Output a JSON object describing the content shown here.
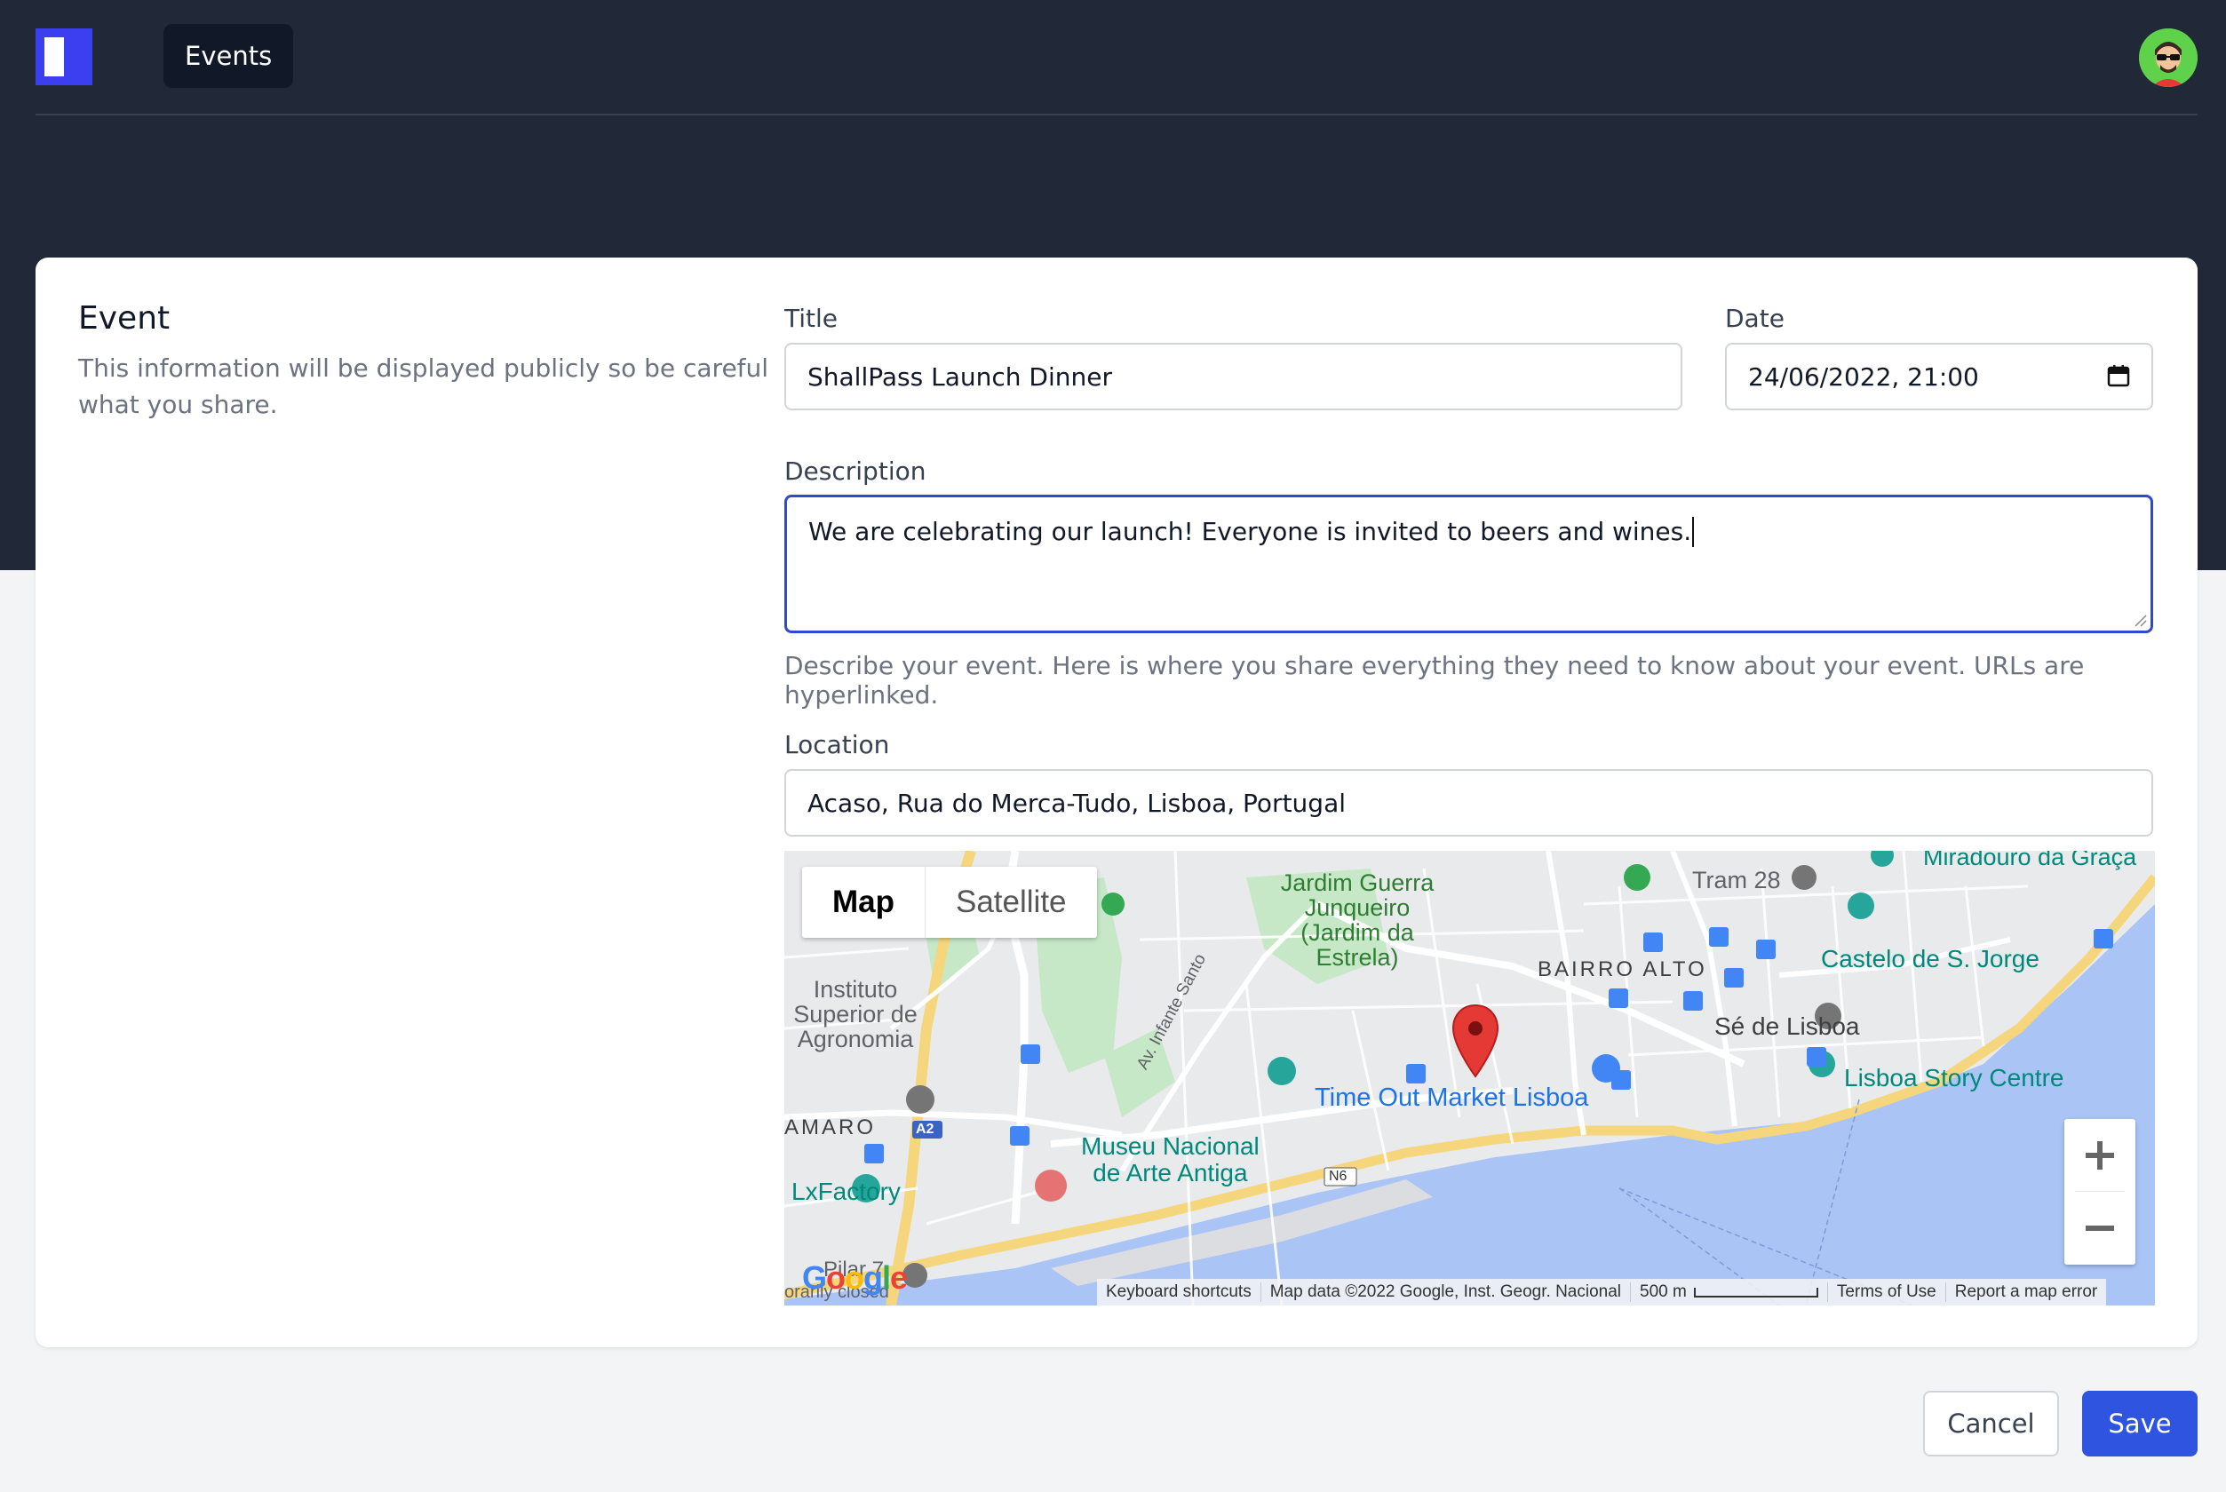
{
  "nav": {
    "tab_events": "Events"
  },
  "section": {
    "title": "Event",
    "description": "This information will be displayed publicly so be careful what you share."
  },
  "form": {
    "title_label": "Title",
    "title_value": "ShallPass Launch Dinner",
    "date_label": "Date",
    "date_value": "24/06/2022, 21:00",
    "description_label": "Description",
    "description_value": "We are celebrating our launch! Everyone is invited to beers and wines.",
    "description_help": "Describe your event. Here is where you share everything they need to know about your event. URLs are hyperlinked.",
    "location_label": "Location",
    "location_value": "Acaso, Rua do Merca-Tudo, Lisboa, Portugal"
  },
  "map": {
    "type_map": "Map",
    "type_satellite": "Satellite",
    "zoom_in": "+",
    "zoom_out": "−",
    "places": {
      "jardim": "Jardim Guerra Junqueiro (Jardim da Estrela)",
      "jardim_l1": "Jardim Guerra",
      "jardim_l2": "Junqueiro",
      "jardim_l3": "(Jardim da",
      "jardim_l4": "Estrela)",
      "instituto_l1": "Instituto",
      "instituto_l2": "Superior de",
      "instituto_l3": "Agronomia",
      "amaro": "AMARO",
      "bairro_alto": "BAIRRO ALTO",
      "tram28": "Tram 28",
      "miradouro": "Miradouro da Graça",
      "castelo": "Castelo de S. Jorge",
      "se": "Sé de Lisboa",
      "story": "Lisboa Story Centre",
      "timeout": "Time Out Market Lisboa",
      "museu_l1": "Museu Nacional",
      "museu_l2": "de Arte Antiga",
      "lxfactory": "LxFactory",
      "pilar": "Pilar 7",
      "closed": "orarily closed",
      "av_infante": "Av. Infante Santo",
      "a2": "A2",
      "n6": "N6"
    },
    "attribution": {
      "shortcuts": "Keyboard shortcuts",
      "data": "Map data ©2022 Google, Inst. Geogr. Nacional",
      "scale": "500 m",
      "terms": "Terms of Use",
      "report": "Report a map error"
    },
    "google_logo": "Google",
    "colors": {
      "water": "#aac4f5",
      "land": "#e9eaec",
      "park": "#c6e8c7",
      "highway": "#f6d67d",
      "marker": "#e53935"
    }
  },
  "actions": {
    "cancel": "Cancel",
    "save": "Save"
  },
  "colors": {
    "header_bg": "#212838",
    "primary": "#2f55e0",
    "focus_border": "#3048cf"
  }
}
